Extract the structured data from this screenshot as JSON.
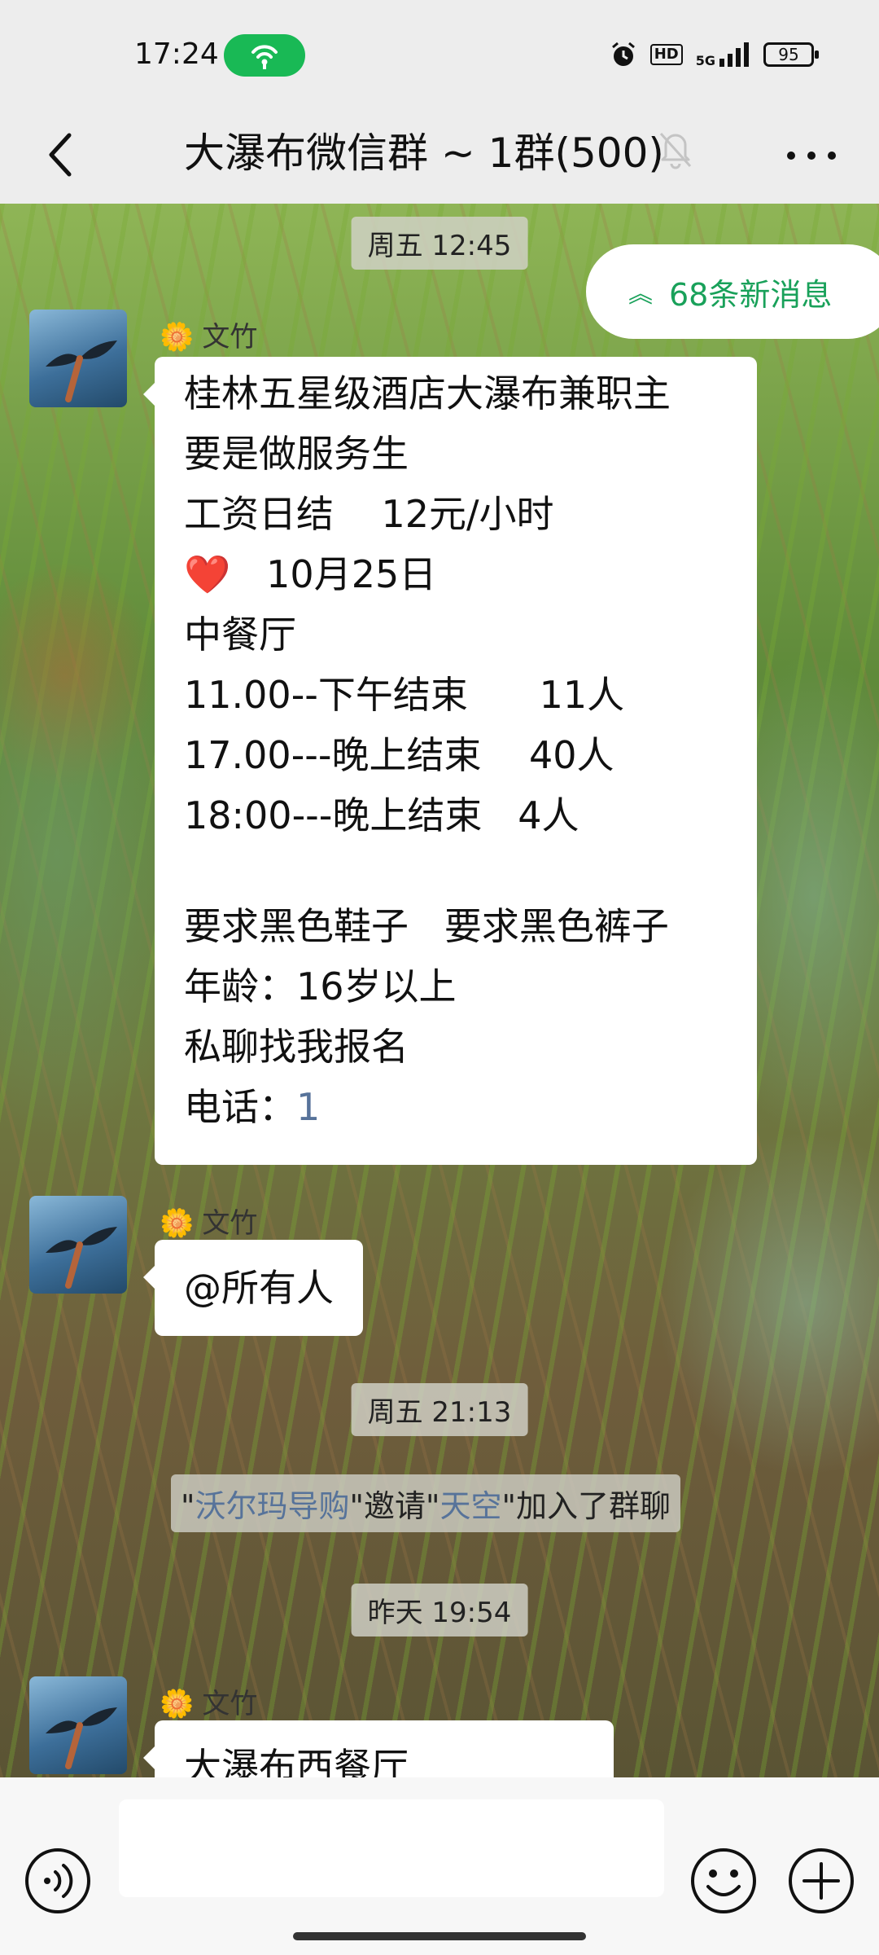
{
  "status_bar": {
    "time": "17:24",
    "battery": "95",
    "hd_label": "HD",
    "network": "5G"
  },
  "header": {
    "title": "大瀑布微信群 ~ 1群(500)"
  },
  "banner": {
    "new_messages": "68条新消息"
  },
  "timestamps": [
    "周五 12:45",
    "周五 21:13",
    "昨天 19:54"
  ],
  "messages": [
    {
      "sender": "文竹",
      "lines": [
        "桂林五星级酒店大瀑布兼职主",
        "要是做服务生",
        "工资日结    12元/小时",
        "10月25日",
        "中餐厅",
        "11.00--下午结束      11人",
        "17.00---晚上结束    40人",
        "18:00---晚上结束   4人",
        "要求黑色鞋子   要求黑色裤子",
        "年龄：16岁以上",
        "私聊找我报名",
        "电话：",
        "1"
      ]
    },
    {
      "sender": "文竹",
      "text": "@所有人"
    },
    {
      "sender": "文竹",
      "text": "大瀑布西餐厅"
    }
  ],
  "system_message": {
    "q1": "\"",
    "inviter": "沃尔玛导购",
    "mid": "\"邀请\"",
    "invitee": "天空",
    "tail": "\"加入了群聊"
  },
  "colors": {
    "accent_green": "#19a15a",
    "hotspot_green": "#19b955",
    "link_blue": "#57739a"
  }
}
